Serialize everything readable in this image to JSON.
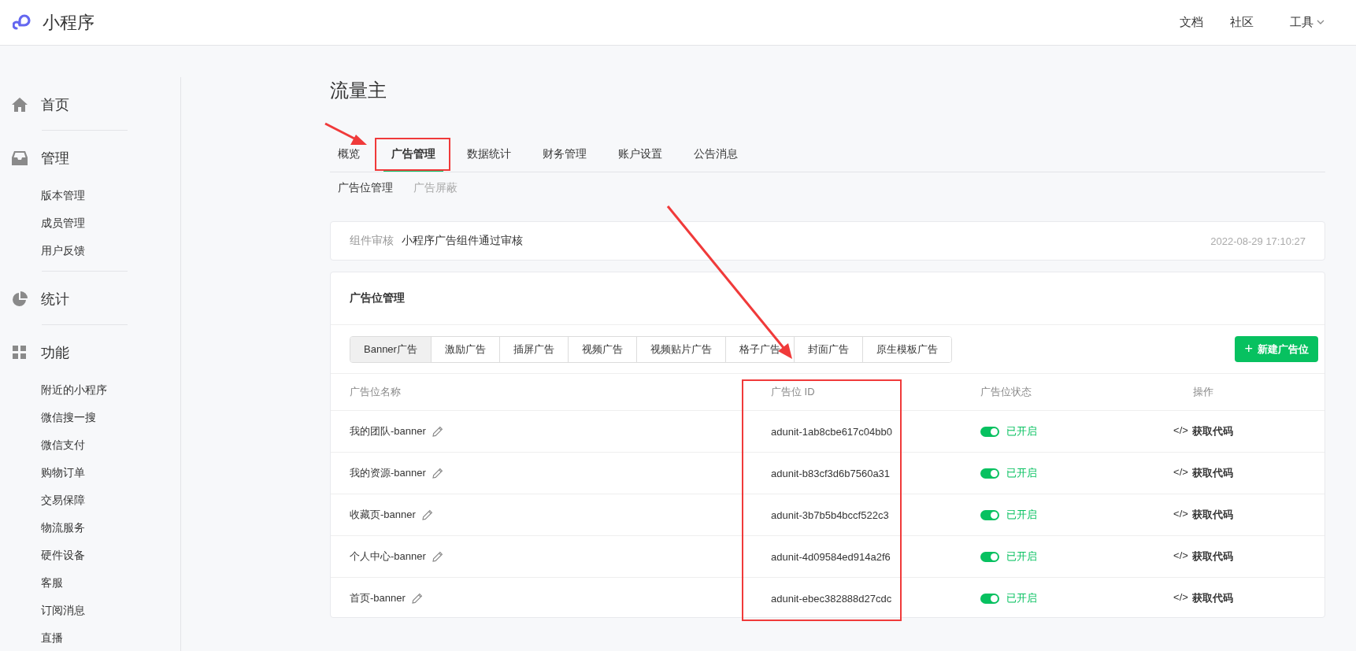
{
  "header": {
    "logo_text": "小程序",
    "nav": [
      {
        "label": "文档",
        "dropdown": false
      },
      {
        "label": "社区",
        "dropdown": false
      },
      {
        "label": "工具",
        "dropdown": true
      }
    ]
  },
  "sidebar": {
    "sections": [
      {
        "label": "首页"
      },
      {
        "label": "管理",
        "items": [
          "版本管理",
          "成员管理",
          "用户反馈"
        ]
      },
      {
        "label": "统计"
      },
      {
        "label": "功能",
        "items": [
          "附近的小程序",
          "微信搜一搜",
          "微信支付",
          "购物订单",
          "交易保障",
          "物流服务",
          "硬件设备",
          "客服",
          "订阅消息",
          "直播"
        ]
      }
    ]
  },
  "page_title": "流量主",
  "tabs": [
    {
      "label": "概览",
      "selected": false,
      "highlighted": false
    },
    {
      "label": "广告管理",
      "selected": true,
      "highlighted": true
    },
    {
      "label": "数据统计",
      "selected": false,
      "highlighted": false
    },
    {
      "label": "财务管理",
      "selected": false,
      "highlighted": false
    },
    {
      "label": "账户设置",
      "selected": false,
      "highlighted": false
    },
    {
      "label": "公告消息",
      "selected": false,
      "highlighted": false
    }
  ],
  "subtabs": [
    {
      "label": "广告位管理",
      "selected": true
    },
    {
      "label": "广告屏蔽",
      "selected": false
    }
  ],
  "notice": {
    "label": "组件审核",
    "text": "小程序广告组件通过审核",
    "time": "2022-08-29 17:10:27"
  },
  "card": {
    "title": "广告位管理",
    "ad_types": [
      {
        "label": "Banner广告",
        "selected": true
      },
      {
        "label": "激励广告",
        "selected": false
      },
      {
        "label": "插屏广告",
        "selected": false
      },
      {
        "label": "视频广告",
        "selected": false
      },
      {
        "label": "视频贴片广告",
        "selected": false
      },
      {
        "label": "格子广告",
        "selected": false
      },
      {
        "label": "封面广告",
        "selected": false
      },
      {
        "label": "原生模板广告",
        "selected": false
      }
    ],
    "new_button": {
      "icon": "+",
      "label": "新建广告位"
    },
    "table": {
      "columns": [
        {
          "label": "广告位名称",
          "highlighted": false
        },
        {
          "label": "广告位 ID",
          "highlighted": true
        },
        {
          "label": "广告位状态",
          "highlighted": false
        },
        {
          "label": "操作",
          "highlighted": false
        }
      ],
      "rows": [
        {
          "name": "我的团队-banner",
          "id": "adunit-1ab8cbe617c04bb0",
          "on": true,
          "status": "已开启",
          "action_icon": "</>",
          "action": "获取代码"
        },
        {
          "name": "我的资源-banner",
          "id": "adunit-b83cf3d6b7560a31",
          "on": true,
          "status": "已开启",
          "action_icon": "</>",
          "action": "获取代码"
        },
        {
          "name": "收藏页-banner",
          "id": "adunit-3b7b5b4bccf522c3",
          "on": true,
          "status": "已开启",
          "action_icon": "</>",
          "action": "获取代码"
        },
        {
          "name": "个人中心-banner",
          "id": "adunit-4d09584ed914a2f6",
          "on": true,
          "status": "已开启",
          "action_icon": "</>",
          "action": "获取代码"
        },
        {
          "name": "首页-banner",
          "id": "adunit-ebec382888d27cdc",
          "on": true,
          "status": "已开启",
          "action_icon": "</>",
          "action": "获取代码"
        }
      ]
    }
  }
}
